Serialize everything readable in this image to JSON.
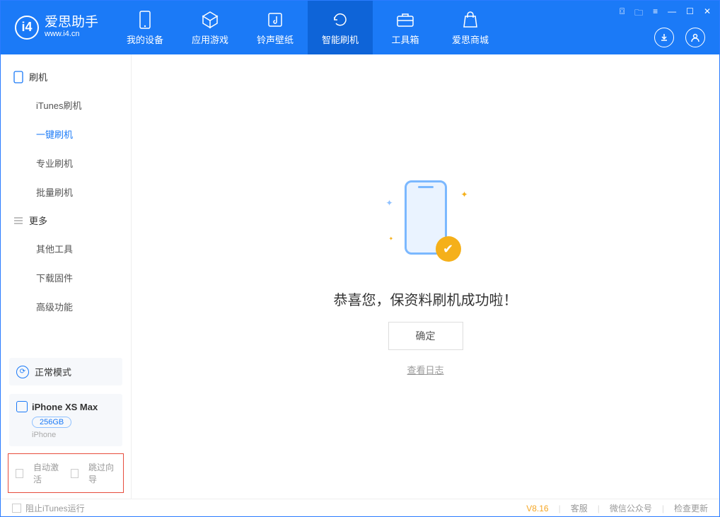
{
  "app": {
    "title": "爱思助手",
    "subtitle": "www.i4.cn"
  },
  "nav": {
    "items": [
      {
        "label": "我的设备"
      },
      {
        "label": "应用游戏"
      },
      {
        "label": "铃声壁纸"
      },
      {
        "label": "智能刷机"
      },
      {
        "label": "工具箱"
      },
      {
        "label": "爱思商城"
      }
    ]
  },
  "sidebar": {
    "section1": {
      "title": "刷机",
      "items": [
        "iTunes刷机",
        "一键刷机",
        "专业刷机",
        "批量刷机"
      ]
    },
    "section2": {
      "title": "更多",
      "items": [
        "其他工具",
        "下载固件",
        "高级功能"
      ]
    }
  },
  "device": {
    "mode": "正常模式",
    "name": "iPhone XS Max",
    "storage": "256GB",
    "type": "iPhone"
  },
  "options": {
    "autoActivate": "自动激活",
    "skipGuide": "跳过向导"
  },
  "main": {
    "successMessage": "恭喜您，保资料刷机成功啦！",
    "confirm": "确定",
    "viewLog": "查看日志"
  },
  "footer": {
    "blockItunes": "阻止iTunes运行",
    "version": "V8.16",
    "support": "客服",
    "wechat": "微信公众号",
    "checkUpdate": "检查更新"
  }
}
